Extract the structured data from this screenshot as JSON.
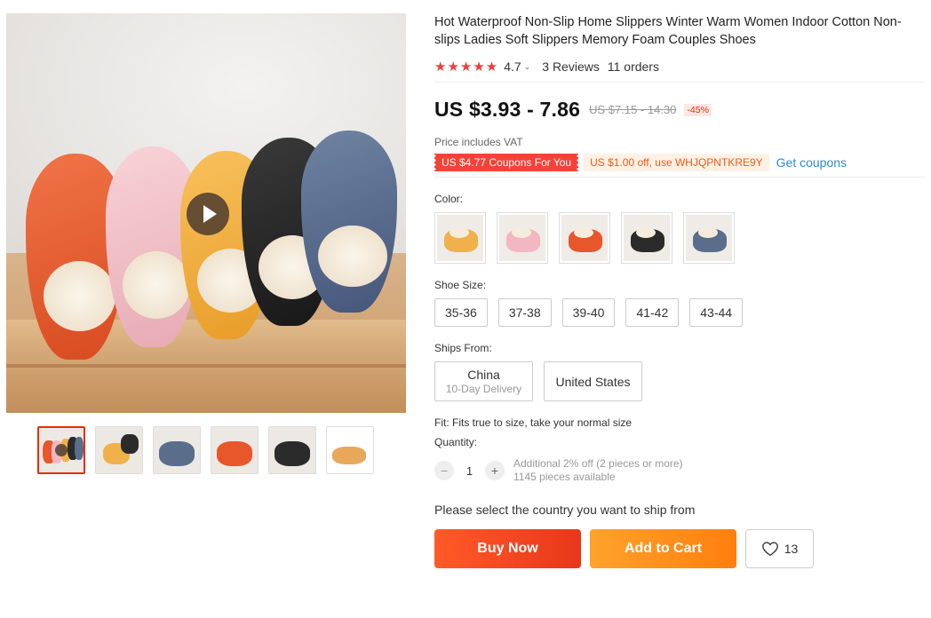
{
  "product": {
    "title": "Hot Waterproof Non-Slip Home Slippers Winter Warm Women Indoor Cotton Non-slips Ladies Soft Slippers Memory Foam Couples Shoes",
    "rating": {
      "stars": "★★★★★",
      "score": "4.7",
      "reviews": "3 Reviews",
      "orders": "11 orders"
    },
    "price": {
      "current": "US $3.93 - 7.86",
      "original": "US $7.15 - 14.30",
      "discount": "-45%",
      "vat_note": "Price includes VAT"
    },
    "coupons": {
      "store_coupon": "US $4.77 Coupons For You",
      "code_offer": "US $1.00 off, use WHJQPNTKRE9Y",
      "get_link": "Get coupons"
    }
  },
  "options": {
    "color_label": "Color:",
    "colors": [
      {
        "name": "yellow",
        "hex": "#f0b14a"
      },
      {
        "name": "pink",
        "hex": "#f2b7c2"
      },
      {
        "name": "orange",
        "hex": "#e8562c"
      },
      {
        "name": "black",
        "hex": "#2b2b2b"
      },
      {
        "name": "blue",
        "hex": "#5a6e8c"
      }
    ],
    "size_label": "Shoe Size:",
    "sizes": [
      "35-36",
      "37-38",
      "39-40",
      "41-42",
      "43-44"
    ],
    "ships_label": "Ships From:",
    "ships_from": [
      {
        "name": "China",
        "delivery": "10-Day Delivery"
      },
      {
        "name": "United States",
        "delivery": ""
      }
    ],
    "fit": "Fit: Fits true to size, take your normal size",
    "quantity_label": "Quantity:",
    "quantity": "1",
    "quantity_discount": "Additional 2% off (2 pieces or more)",
    "available": "1145 pieces available",
    "minus": "−",
    "plus": "+"
  },
  "shipping_prompt": "Please select the country you want to ship from",
  "actions": {
    "buy_now": "Buy Now",
    "add_to_cart": "Add to Cart",
    "wishlist_count": "13"
  },
  "colors": {
    "accent_red": "#f44336",
    "buy": "#e8371b",
    "cart": "#ff7f0e",
    "link": "#2e8bd1"
  }
}
